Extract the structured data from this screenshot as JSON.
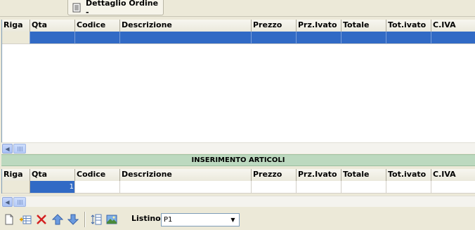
{
  "tab": {
    "title": "Dettaglio Ordine -",
    "icon": "document-icon"
  },
  "columns": [
    "Riga",
    "Qta",
    "Codice",
    "Descrizione",
    "Prezzo",
    "Prz.Ivato",
    "Totale",
    "Tot.ivato",
    "C.IVA"
  ],
  "order_grid": {
    "rows": [
      {
        "riga": "",
        "qta": "",
        "codice": "",
        "descrizione": "",
        "prezzo": "",
        "prz_ivato": "",
        "totale": "",
        "tot_ivato": "",
        "c_iva": "",
        "selected": true
      }
    ]
  },
  "section_title": "INSERIMENTO ARTICOLI",
  "entry_grid": {
    "rows": [
      {
        "riga": "",
        "qta": "1",
        "codice": "",
        "descrizione": "",
        "prezzo": "",
        "prz_ivato": "",
        "totale": "",
        "tot_ivato": "",
        "c_iva": ""
      }
    ]
  },
  "toolbar": {
    "buttons": [
      "new-document-icon",
      "add-row-icon",
      "delete-icon",
      "move-up-icon",
      "move-down-icon",
      "insert-line-icon",
      "image-icon"
    ],
    "listino_label": "Listino",
    "listino_value": "P1"
  },
  "colors": {
    "selection": "#316ac5",
    "band": "#bcd9bf",
    "background": "#ece9d8"
  }
}
